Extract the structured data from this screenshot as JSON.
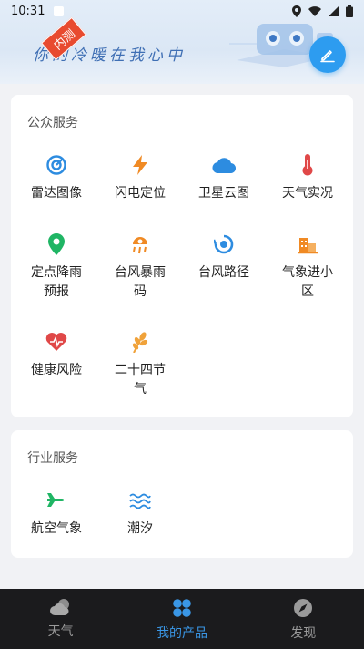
{
  "status_bar": {
    "time": "10:31"
  },
  "banner": {
    "slogan": "你的冷暖在我心中",
    "badge": "内测"
  },
  "public_services": {
    "title": "公众服务",
    "items": [
      {
        "label": "雷达图像",
        "icon": "radar-icon",
        "color": "#2d8ce0"
      },
      {
        "label": "闪电定位",
        "icon": "lightning-icon",
        "color": "#f08a24"
      },
      {
        "label": "卫星云图",
        "icon": "cloud-icon",
        "color": "#2d8ce0"
      },
      {
        "label": "天气实况",
        "icon": "thermometer-icon",
        "color": "#e04848"
      },
      {
        "label": "定点降雨预报",
        "icon": "location-pin-icon",
        "color": "#1fb564"
      },
      {
        "label": "台风暴雨码",
        "icon": "typhoon-rain-icon",
        "color": "#f08a24"
      },
      {
        "label": "台风路径",
        "icon": "typhoon-icon",
        "color": "#2d8ce0"
      },
      {
        "label": "气象进小区",
        "icon": "building-icon",
        "color": "#f08a24"
      },
      {
        "label": "健康风险",
        "icon": "heart-pulse-icon",
        "color": "#e04848"
      },
      {
        "label": "二十四节气",
        "icon": "wheat-icon",
        "color": "#f0a23a"
      }
    ]
  },
  "industry_services": {
    "title": "行业服务",
    "items": [
      {
        "label": "航空气象",
        "icon": "airplane-icon",
        "color": "#1fb564"
      },
      {
        "label": "潮汐",
        "icon": "waves-icon",
        "color": "#2d8ce0"
      }
    ]
  },
  "bottom_nav": {
    "active": "我的产品",
    "items": [
      {
        "label": "天气",
        "icon": "weather-cloud-icon"
      },
      {
        "label": "我的产品",
        "icon": "grid-icon"
      },
      {
        "label": "发现",
        "icon": "compass-icon"
      }
    ]
  }
}
